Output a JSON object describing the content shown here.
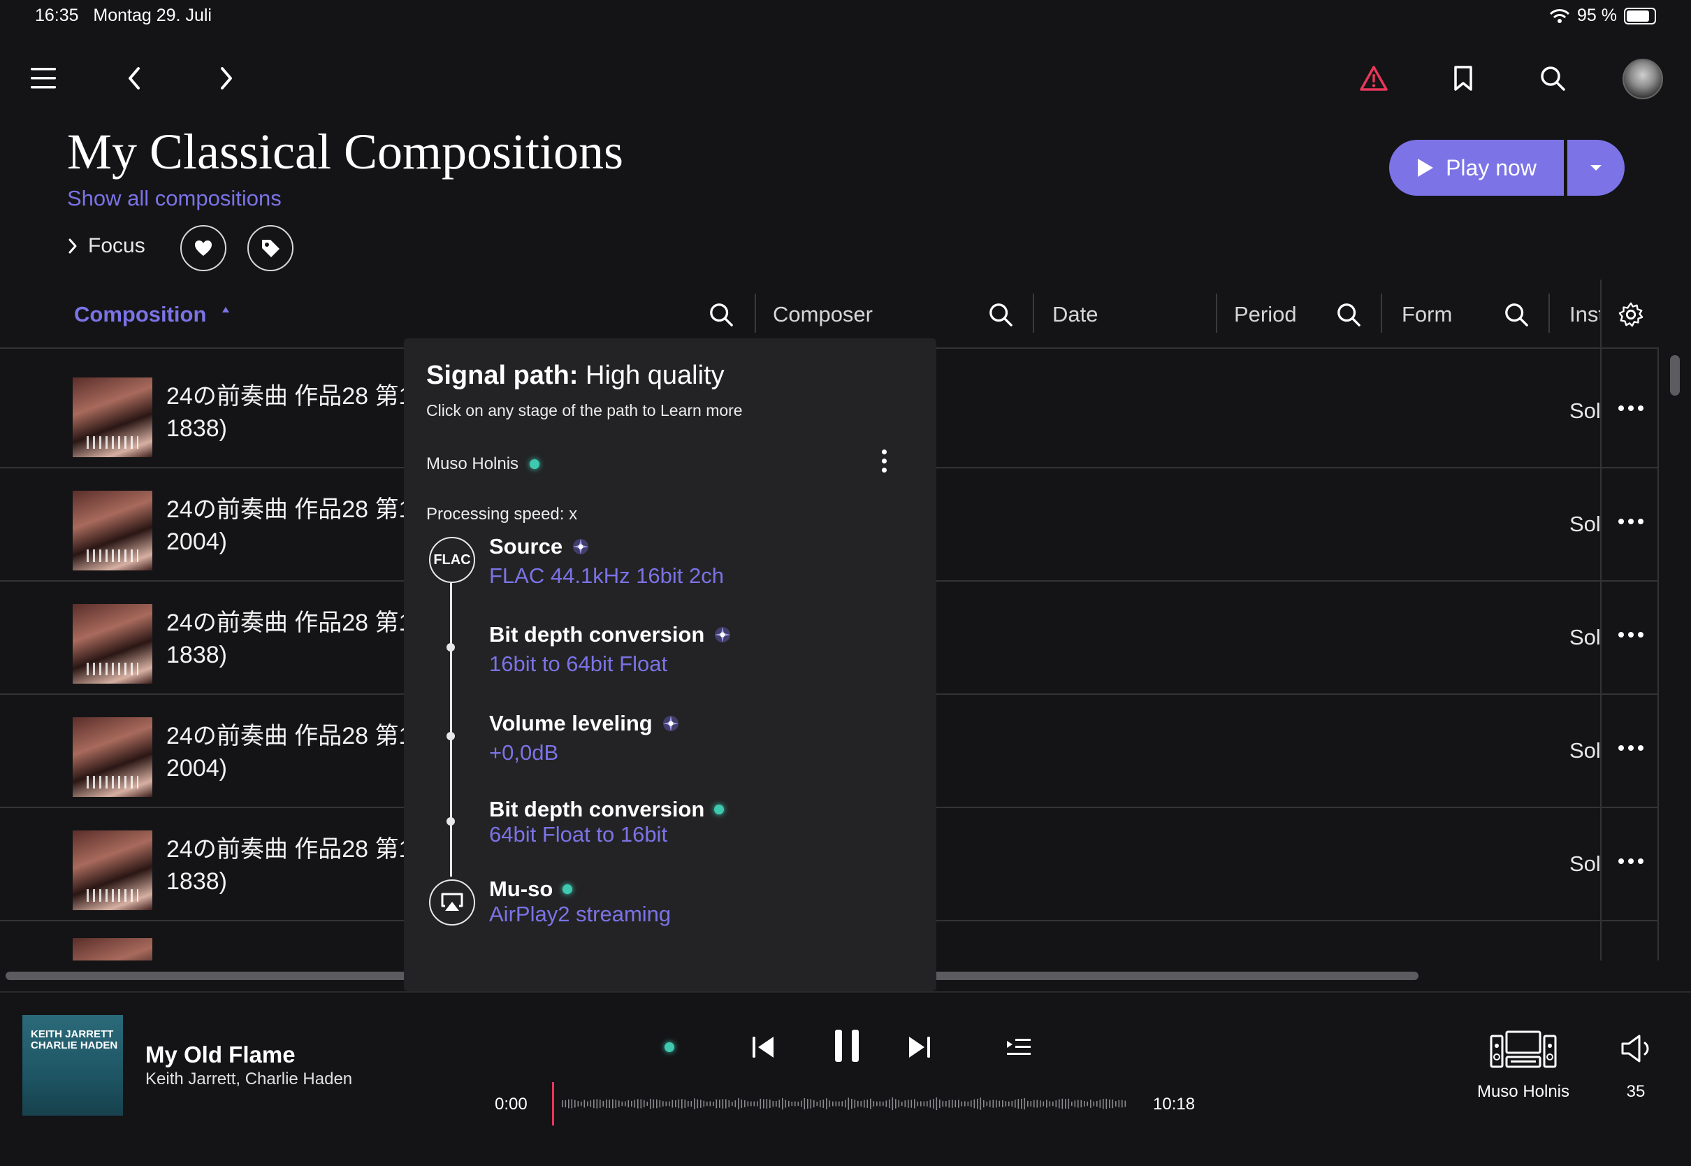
{
  "status_bar": {
    "time": "16:35",
    "date": "Montag 29. Juli",
    "battery": "95 %",
    "battery_level": 0.95
  },
  "nav": {
    "icons": [
      "menu-icon",
      "back-icon",
      "forward-icon",
      "warning-icon",
      "bookmark-icon",
      "search-icon",
      "avatar"
    ]
  },
  "header": {
    "title": "My Classical Compositions",
    "show_all": "Show all compositions",
    "focus": "Focus"
  },
  "play_button": {
    "label": "Play now"
  },
  "columns": [
    {
      "label": "Composition",
      "sorted": "ascending",
      "active": true
    },
    {
      "label": "Composer"
    },
    {
      "label": "Date"
    },
    {
      "label": "Period"
    },
    {
      "label": "Form"
    },
    {
      "label": "Inst"
    }
  ],
  "rows": [
    {
      "line1": "24の前奏曲 作品28 第1",
      "line2": "1838)",
      "instrument": "Solo"
    },
    {
      "line1": "24の前奏曲 作品28 第1",
      "line2": "2004)",
      "instrument": "Solo"
    },
    {
      "line1": "24の前奏曲 作品28 第1",
      "line2": "1838)",
      "instrument": "Solo"
    },
    {
      "line1": "24の前奏曲 作品28 第1",
      "line2": "2004)",
      "instrument": "Solo"
    },
    {
      "line1": "24の前奏曲 作品28 第1",
      "line2": "1838)",
      "instrument": "Solo"
    }
  ],
  "signal_path": {
    "title_bold": "Signal path:",
    "title_rest": "High quality",
    "subtitle": "Click on any stage of the path to Learn more",
    "device": "Muso Holnis",
    "speed": "Processing speed: x",
    "source_badge": "FLAC",
    "stages": [
      {
        "name": "Source",
        "detail": "FLAC 44.1kHz 16bit 2ch",
        "quality": "enhanced"
      },
      {
        "name": "Bit depth conversion",
        "detail": "16bit to 64bit Float",
        "quality": "enhanced"
      },
      {
        "name": "Volume leveling",
        "detail": "+0,0dB",
        "quality": "enhanced"
      },
      {
        "name": "Bit depth conversion",
        "detail": "64bit Float to 16bit",
        "quality": "high"
      },
      {
        "name": "Mu-so",
        "detail": "AirPlay2 streaming",
        "quality": "high"
      }
    ],
    "colors": {
      "enhanced": "#7b73e6",
      "high": "#3ec9b0"
    }
  },
  "player": {
    "album_text": "KEITH JARRETT\nCHARLIE HADEN",
    "track": "My Old Flame",
    "artist": "Keith Jarrett, Charlie Haden",
    "elapsed": "0:00",
    "duration": "10:18",
    "progress": 0.0,
    "device": "Muso Holnis",
    "volume": "35"
  },
  "colors": {
    "accent": "#7b73e6",
    "warning": "#e8375a",
    "quality_high": "#3ec9b0",
    "background": "#141416",
    "popup": "#232325"
  }
}
